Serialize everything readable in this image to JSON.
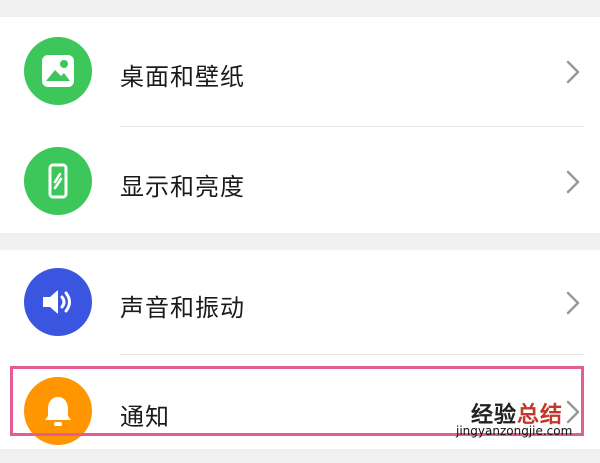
{
  "settings": {
    "items": [
      {
        "label": "桌面和壁纸",
        "icon": "wallpaper-image-icon",
        "color": "#3dc75a"
      },
      {
        "label": "显示和亮度",
        "icon": "phone-display-icon",
        "color": "#3dc75a"
      },
      {
        "label": "声音和振动",
        "icon": "speaker-volume-icon",
        "color": "#3a56e0"
      },
      {
        "label": "通知",
        "icon": "bell-icon",
        "color": "#ff9500"
      }
    ]
  },
  "highlight_color": "#e45b95",
  "watermark": {
    "brand_part1": "经验",
    "brand_part2": "总结",
    "url": "jingyanzongjie.com"
  }
}
